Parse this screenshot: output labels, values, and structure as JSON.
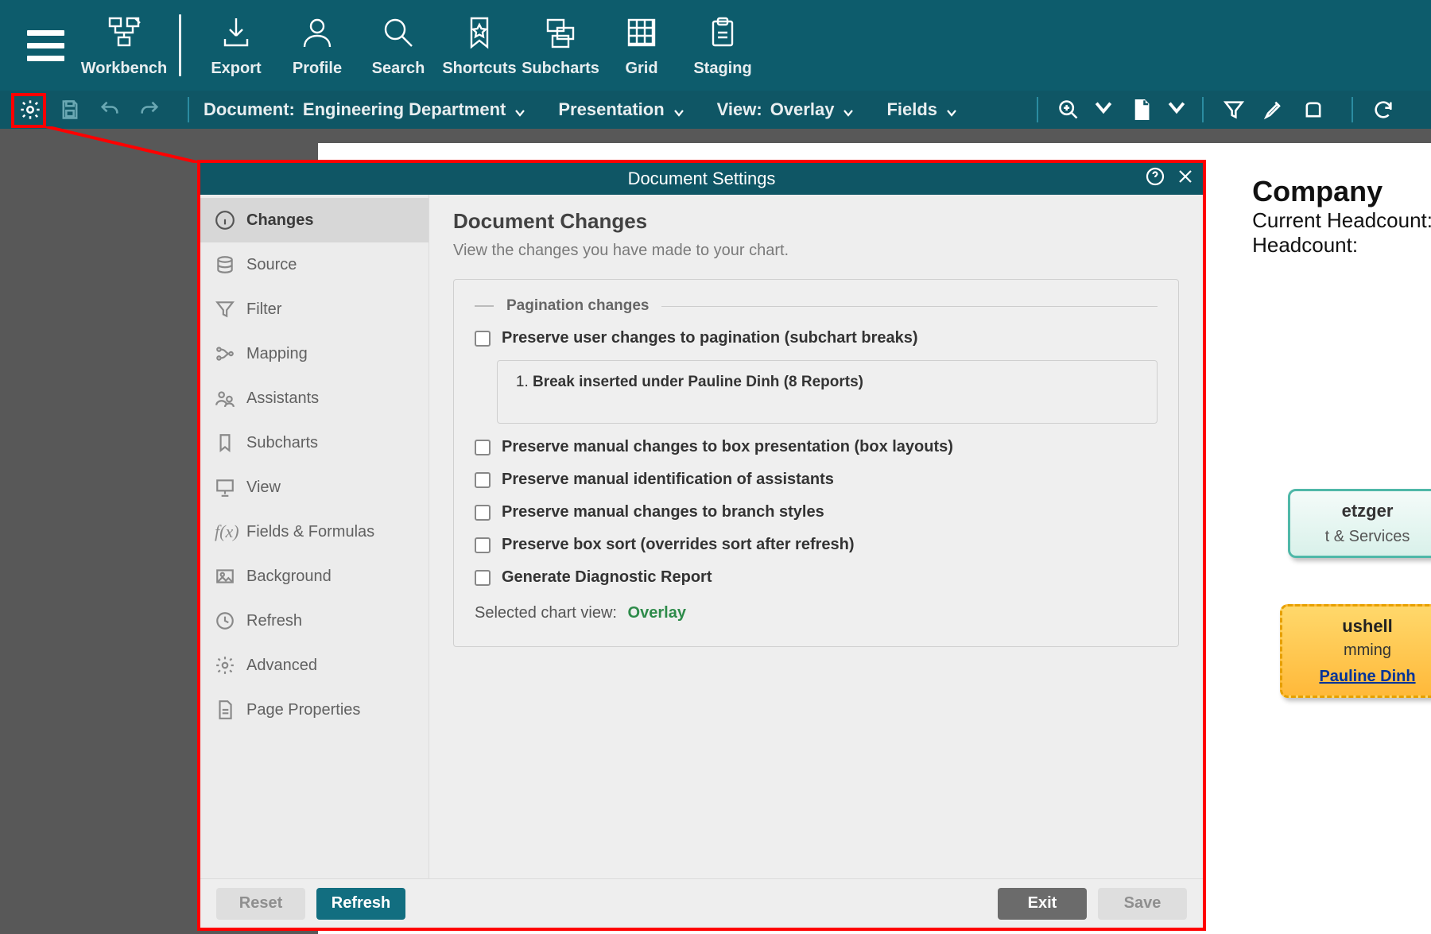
{
  "toolbar": {
    "items": [
      {
        "id": "workbench",
        "label": "Workbench"
      },
      {
        "id": "export",
        "label": "Export"
      },
      {
        "id": "profile",
        "label": "Profile"
      },
      {
        "id": "search",
        "label": "Search"
      },
      {
        "id": "shortcuts",
        "label": "Shortcuts"
      },
      {
        "id": "subcharts",
        "label": "Subcharts"
      },
      {
        "id": "grid",
        "label": "Grid"
      },
      {
        "id": "staging",
        "label": "Staging"
      }
    ]
  },
  "subtoolbar": {
    "document_label": "Document:",
    "document_value": "Engineering Department",
    "presentation_label": "Presentation",
    "view_label": "View:",
    "view_value": "Overlay",
    "fields_label": "Fields"
  },
  "page": {
    "title": "Company",
    "line1": "Current Headcount:",
    "line2": "Headcount:"
  },
  "cards": {
    "teal_name": "etzger",
    "teal_role": "t & Services",
    "orange_name": "ushell",
    "orange_role": "mming",
    "orange_link": "Pauline Dinh"
  },
  "dialog": {
    "title": "Document Settings",
    "nav": [
      {
        "id": "changes",
        "label": "Changes"
      },
      {
        "id": "source",
        "label": "Source"
      },
      {
        "id": "filter",
        "label": "Filter"
      },
      {
        "id": "mapping",
        "label": "Mapping"
      },
      {
        "id": "assistants",
        "label": "Assistants"
      },
      {
        "id": "subcharts",
        "label": "Subcharts"
      },
      {
        "id": "view",
        "label": "View"
      },
      {
        "id": "fields",
        "label": "Fields & Formulas"
      },
      {
        "id": "background",
        "label": "Background"
      },
      {
        "id": "refresh",
        "label": "Refresh"
      },
      {
        "id": "advanced",
        "label": "Advanced"
      },
      {
        "id": "pageprops",
        "label": "Page Properties"
      }
    ],
    "heading": "Document Changes",
    "subtitle": "View the changes you have made to your chart.",
    "group_pagination": "Pagination changes",
    "chk_pagination": "Preserve user changes to pagination (subchart breaks)",
    "change_entry": "Break inserted under Pauline Dinh (8 Reports)",
    "chk_box_presentation": "Preserve manual changes to box presentation (box layouts)",
    "chk_assistants": "Preserve manual identification of assistants",
    "chk_branch": "Preserve manual changes to branch styles",
    "chk_sort": "Preserve box sort (overrides sort after refresh)",
    "chk_diag": "Generate Diagnostic Report",
    "selected_view_label": "Selected chart view:",
    "selected_view_value": "Overlay",
    "buttons": {
      "reset": "Reset",
      "refresh": "Refresh",
      "exit": "Exit",
      "save": "Save"
    }
  }
}
